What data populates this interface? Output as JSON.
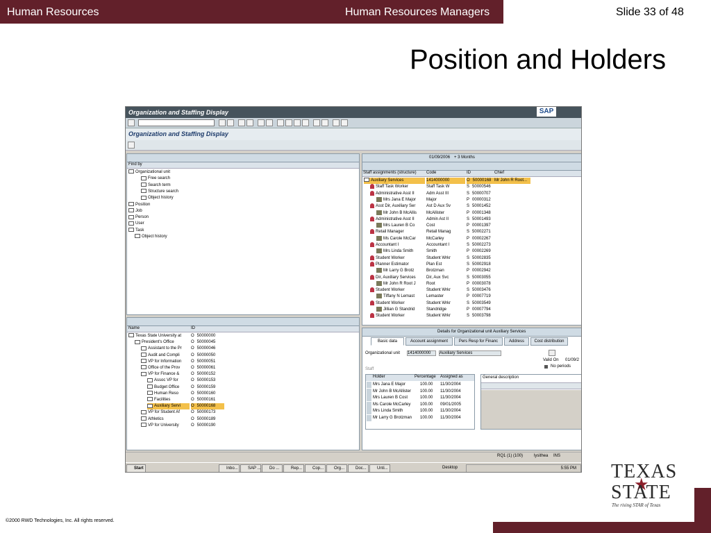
{
  "slide": {
    "header_left": "Human Resources",
    "header_mid": "Human Resources Managers",
    "header_right": "Slide 33 of 48",
    "title": "Position and Holders",
    "copyright": "©2000 RWD Technologies, Inc.  All rights reserved.",
    "logo_line1": "TEXAS",
    "logo_line2": "STATE",
    "logo_tagline": "The rising STAR of Texas",
    "brand_color": "#62202a"
  },
  "sap": {
    "window_title": "Organization and Staffing Display",
    "logo": "SAP",
    "header_title": "Organization and Staffing Display",
    "find_by": {
      "label": "Find by",
      "items": [
        {
          "label": "Organizational unit",
          "level": 0,
          "icon": "folder-icon"
        },
        {
          "label": "Free search",
          "level": 2,
          "icon": "binoculars-icon"
        },
        {
          "label": "Search term",
          "level": 2,
          "icon": "binoculars-icon"
        },
        {
          "label": "Structure search",
          "level": 2,
          "icon": "binoculars-icon"
        },
        {
          "label": "Object history",
          "level": 2,
          "icon": "binoculars-icon"
        },
        {
          "label": "Position",
          "level": 0,
          "icon": "person-icon"
        },
        {
          "label": "Job",
          "level": 0,
          "icon": "job-icon"
        },
        {
          "label": "Person",
          "level": 0,
          "icon": "people-icon"
        },
        {
          "label": "User",
          "level": 0,
          "icon": "user-icon"
        },
        {
          "label": "Task",
          "level": 0,
          "icon": "task-icon"
        },
        {
          "label": "Object history",
          "level": 1,
          "icon": "history-icon"
        }
      ]
    },
    "hitlist": {
      "columns": [
        "Name",
        "ID"
      ],
      "rows": [
        {
          "name": "Texas State University at",
          "type": "O",
          "id": "50000000",
          "level": 0
        },
        {
          "name": "President's Office",
          "type": "O",
          "id": "50000045",
          "level": 1
        },
        {
          "name": "Assistant to the Pr",
          "type": "O",
          "id": "50000046",
          "level": 2
        },
        {
          "name": "Audit and Compli",
          "type": "O",
          "id": "50000050",
          "level": 2
        },
        {
          "name": "VP for Information",
          "type": "O",
          "id": "50000051",
          "level": 2
        },
        {
          "name": "Office of the Prov",
          "type": "O",
          "id": "50000061",
          "level": 2
        },
        {
          "name": "VP for Finance &",
          "type": "O",
          "id": "50000152",
          "level": 2
        },
        {
          "name": "Assoc VP for",
          "type": "O",
          "id": "50000153",
          "level": 3
        },
        {
          "name": "Budget Office",
          "type": "O",
          "id": "50000159",
          "level": 3
        },
        {
          "name": "Human Reso",
          "type": "O",
          "id": "50000160",
          "level": 3
        },
        {
          "name": "Facilities",
          "type": "O",
          "id": "50000161",
          "level": 3
        },
        {
          "name": "Auxiliary Servi",
          "type": "O",
          "id": "50000168",
          "level": 3,
          "highlight": true
        },
        {
          "name": "VP for Student Af",
          "type": "O",
          "id": "50000173",
          "level": 2
        },
        {
          "name": "Athletics",
          "type": "O",
          "id": "50000189",
          "level": 2
        },
        {
          "name": "VP for University",
          "type": "O",
          "id": "50000190",
          "level": 2
        }
      ]
    },
    "overview": {
      "key_date": "01/09/2006",
      "period": "+ 3 Months",
      "columns": [
        "Staff assignments (structure)",
        "Code",
        "ID",
        "Chief"
      ],
      "rows": [
        {
          "name": "Auxiliary Services",
          "code": "1414000000",
          "type": "O",
          "id": "50000168",
          "chief": "Mr John R Root...",
          "level": 0,
          "icon": "folder",
          "highlight": true
        },
        {
          "name": "Staff Task Worker",
          "code": "Staff Task W",
          "type": "S",
          "id": "50000546",
          "chief": "",
          "level": 1,
          "icon": "position"
        },
        {
          "name": "Administrative Asst II",
          "code": "Adm Asst III",
          "type": "S",
          "id": "50000707",
          "chief": "",
          "level": 1,
          "icon": "position"
        },
        {
          "name": "Mrs Jana E Major",
          "code": "Major",
          "type": "P",
          "id": "00000312",
          "chief": "",
          "level": 2,
          "icon": "person"
        },
        {
          "name": "Asst Dir, Auxiliary Ser",
          "code": "Ast D Aux Sv",
          "type": "S",
          "id": "50001452",
          "chief": "",
          "level": 1,
          "icon": "position"
        },
        {
          "name": "Mr John B McAllis",
          "code": "McAllister",
          "type": "P",
          "id": "00001348",
          "chief": "",
          "level": 2,
          "icon": "person"
        },
        {
          "name": "Administrative Asst II",
          "code": "Admin Ast II",
          "type": "S",
          "id": "50001493",
          "chief": "",
          "level": 1,
          "icon": "position"
        },
        {
          "name": "Mrs Lauren B Co",
          "code": "Cost",
          "type": "P",
          "id": "00001397",
          "chief": "",
          "level": 2,
          "icon": "person"
        },
        {
          "name": "Retail Manager",
          "code": "Retail Manag",
          "type": "S",
          "id": "50002271",
          "chief": "",
          "level": 1,
          "icon": "position"
        },
        {
          "name": "Ms Carole McCar",
          "code": "McCarley",
          "type": "P",
          "id": "00002267",
          "chief": "",
          "level": 2,
          "icon": "person"
        },
        {
          "name": "Accountant I",
          "code": "Accountant I",
          "type": "S",
          "id": "50002273",
          "chief": "",
          "level": 1,
          "icon": "position"
        },
        {
          "name": "Mrs Linda Smith",
          "code": "Smith",
          "type": "P",
          "id": "00002269",
          "chief": "",
          "level": 2,
          "icon": "person"
        },
        {
          "name": "Student Worker",
          "code": "Student Wrkr",
          "type": "S",
          "id": "50002835",
          "chief": "",
          "level": 1,
          "icon": "position"
        },
        {
          "name": "Planner Estimator",
          "code": "Plan Est",
          "type": "S",
          "id": "50002918",
          "chief": "",
          "level": 1,
          "icon": "position"
        },
        {
          "name": "Mr Larry G Brotz",
          "code": "Brotzman",
          "type": "P",
          "id": "00002942",
          "chief": "",
          "level": 2,
          "icon": "person"
        },
        {
          "name": "Dir, Auxiliary Services",
          "code": "Dir, Aux Svc",
          "type": "S",
          "id": "50003055",
          "chief": "",
          "level": 1,
          "icon": "position-chief"
        },
        {
          "name": "Mr John R Root J",
          "code": "Root",
          "type": "P",
          "id": "00003078",
          "chief": "",
          "level": 2,
          "icon": "person"
        },
        {
          "name": "Student Worker",
          "code": "Student Wrkr",
          "type": "S",
          "id": "50003476",
          "chief": "",
          "level": 1,
          "icon": "position"
        },
        {
          "name": "Tiffany N Lemast",
          "code": "Lemaster",
          "type": "P",
          "id": "00007719",
          "chief": "",
          "level": 2,
          "icon": "person"
        },
        {
          "name": "Student Worker",
          "code": "Student Wrkr",
          "type": "S",
          "id": "50003549",
          "chief": "",
          "level": 1,
          "icon": "position"
        },
        {
          "name": "Jillian G Standrid",
          "code": "Standridge",
          "type": "P",
          "id": "00007794",
          "chief": "",
          "level": 2,
          "icon": "person"
        },
        {
          "name": "Student Worker",
          "code": "Student Wrkr",
          "type": "S",
          "id": "50003798",
          "chief": "",
          "level": 1,
          "icon": "position"
        }
      ]
    },
    "details": {
      "title": "Details for Organizational unit Auxiliary Services",
      "tabs": [
        "Basic data",
        "Account assignment",
        "Pers Resp for Financ",
        "Address",
        "Cost distribution"
      ],
      "org_unit_label": "Organizational unit",
      "org_unit_code": "1414000000",
      "org_unit_name": "Auxiliary Services",
      "valid_on_label": "Valid On",
      "valid_on_value": "01/09/2",
      "no_periods": "No periods",
      "staff_label": "Staff",
      "general_description": "General description",
      "holders_columns": [
        "Holder",
        "Percentage",
        "Assigned as"
      ],
      "holders": [
        {
          "holder": "Mrs Jana E Major",
          "pct": "100.00",
          "date": "11/30/2004"
        },
        {
          "holder": "Mr John B McAllister",
          "pct": "100.00",
          "date": "11/30/2004"
        },
        {
          "holder": "Mrs Lauren B Cost",
          "pct": "100.00",
          "date": "11/30/2004"
        },
        {
          "holder": "Ms Carole McCarley",
          "pct": "100.00",
          "date": "09/01/2005"
        },
        {
          "holder": "Mrs Linda Smith",
          "pct": "100.00",
          "date": "11/30/2004"
        },
        {
          "holder": "Mr Larry G Brotzman",
          "pct": "100.00",
          "date": "11/30/2004"
        }
      ]
    },
    "status": {
      "system": "RQ1 (1) (100)",
      "user": "lysithea",
      "mode": "INS"
    },
    "taskbar": {
      "start": "Start",
      "items": [
        "Inbo...",
        "SAP ...",
        "Do ...",
        "Rep...",
        "Cop...",
        "Org...",
        "Doc...",
        "Unti..."
      ],
      "desktop": "Desktop",
      "time": "5:55 PM"
    }
  }
}
